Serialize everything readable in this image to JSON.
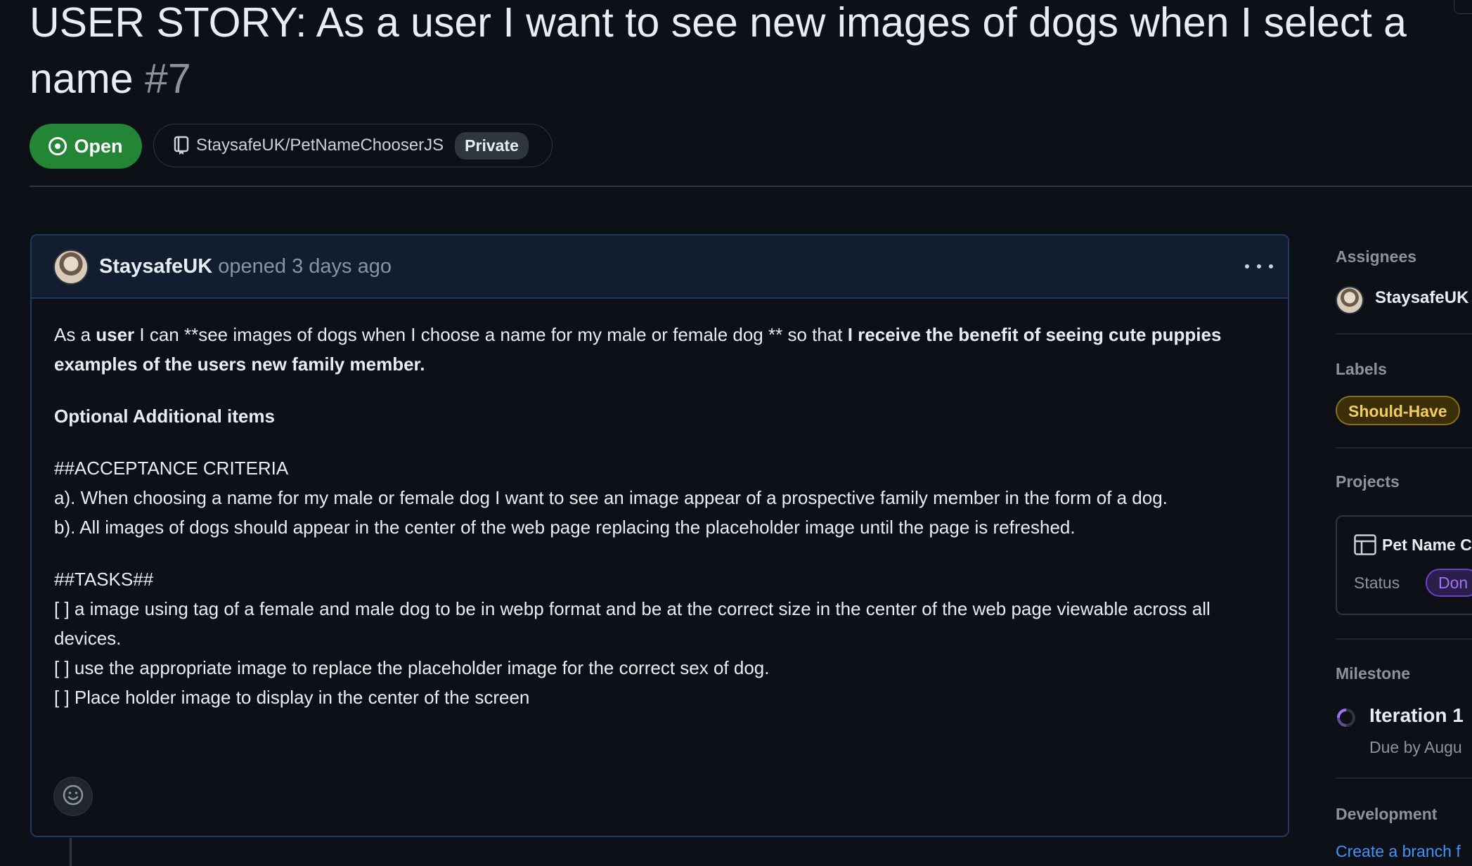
{
  "issue": {
    "title": "USER STORY: As a user I want to see new images of dogs when I select a name",
    "number": "#7",
    "state": "Open",
    "repo": "StaysafeUK/PetNameChooserJS",
    "visibility": "Private"
  },
  "comment": {
    "author": "StaysafeUK",
    "meta": "opened 3 days ago",
    "body": {
      "p1_a": "As a ",
      "p1_b": "user",
      "p1_c": " I can **see images of dogs when I choose a name for my male or female dog ** so that ",
      "p1_d": "I receive the benefit of seeing cute puppies examples of the users new family member.",
      "optional": "Optional Additional items",
      "ac_heading": "##ACCEPTANCE CRITERIA",
      "ac_a": "a). When choosing a name for my male or female dog I want to see an image appear of a prospective family member in the form of a dog.",
      "ac_b": "b). All images of dogs should appear in the center of the web page replacing the placeholder image until the page is refreshed.",
      "tasks_heading": "##TASKS##",
      "task_1": "[ ] a image using  tag of a female and male dog to be in webp format and be at the correct size in the center of the web page viewable across all devices.",
      "task_2": "[ ] use the appropriate image to replace the placeholder image for the correct sex of dog.",
      "task_3": "[ ] Place holder image to display in the center of the screen"
    }
  },
  "sidebar": {
    "assignees_heading": "Assignees",
    "assignee": "StaysafeUK",
    "labels_heading": "Labels",
    "label": "Should-Have",
    "projects_heading": "Projects",
    "project_name": "Pet Name C",
    "status_label": "Status",
    "status_value": "Don",
    "milestone_heading": "Milestone",
    "milestone_name": "Iteration 1",
    "milestone_due": "Due by Augu",
    "development_heading": "Development",
    "create_branch": "Create a branch f"
  },
  "colors": {
    "background": "#0d1117",
    "open_green": "#238636",
    "label_yellow": "#f2cc60",
    "status_purple": "#a371f7",
    "link_blue": "#4493f8"
  }
}
